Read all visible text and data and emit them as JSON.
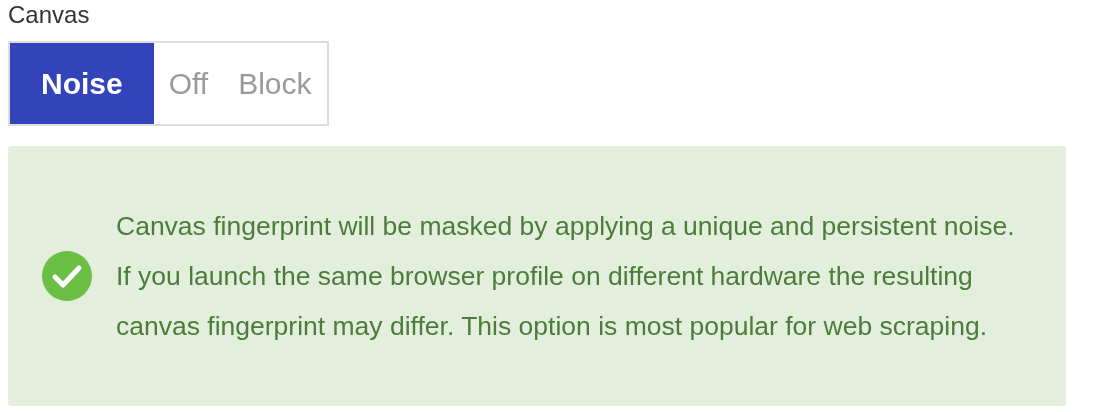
{
  "section": {
    "label": "Canvas"
  },
  "modes": [
    {
      "label": "Noise",
      "selected": true
    },
    {
      "label": "Off",
      "selected": false
    },
    {
      "label": "Block",
      "selected": false
    }
  ],
  "alert": {
    "kind": "success",
    "text": "Canvas fingerprint will be masked by applying a unique and persistent noise. If you launch the same browser profile on different hardware the resulting canvas fingerprint may differ. This option is most popular for web scraping."
  }
}
